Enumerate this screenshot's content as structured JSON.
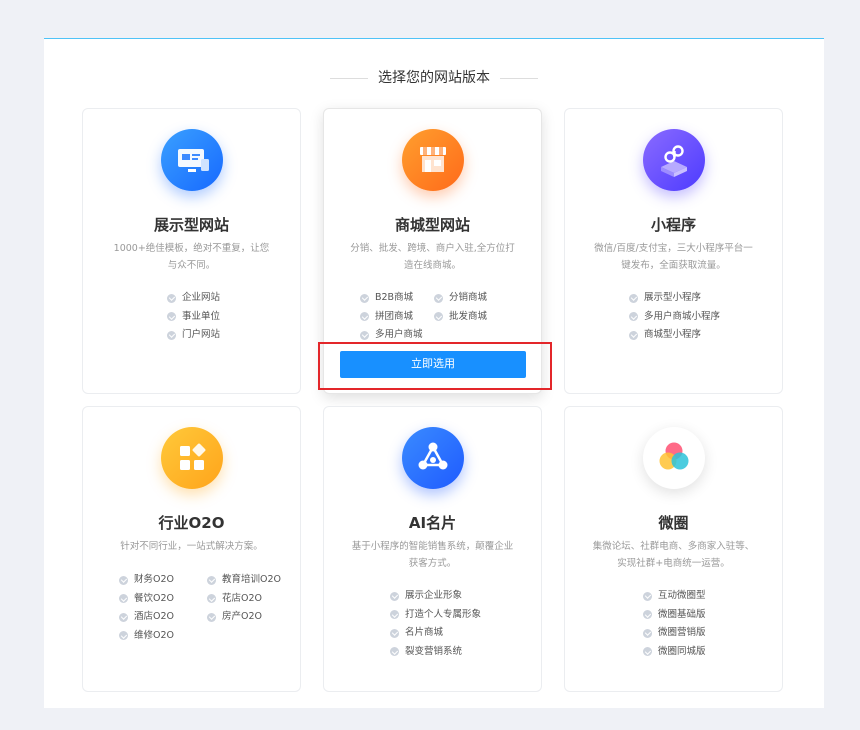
{
  "section_title": "选择您的网站版本",
  "cards": [
    {
      "icon": "display-screen-icon",
      "title": "展示型网站",
      "desc": "1000+绝佳模板，绝对不重复，让您与众不同。",
      "features": [
        "企业网站",
        "事业单位",
        "门户网站"
      ]
    },
    {
      "icon": "storefront-icon",
      "title": "商城型网站",
      "desc": "分销、批发、跨境、商户入驻,全方位打造在线商城。",
      "features": [
        "B2B商城",
        "分销商城",
        "拼团商城",
        "批发商城",
        "多用户商城"
      ],
      "button": "立即选用"
    },
    {
      "icon": "mini-program-icon",
      "title": "小程序",
      "desc": "微信/百度/支付宝，三大小程序平台一键发布，全面获取流量。",
      "features": [
        "展示型小程序",
        "多用户商城小程序",
        "商城型小程序"
      ]
    },
    {
      "icon": "blocks-icon",
      "title": "行业O2O",
      "desc": "针对不同行业，一站式解决方案。",
      "features": [
        "财务O2O",
        "教育培训O2O",
        "餐饮O2O",
        "花店O2O",
        "酒店O2O",
        "房产O2O",
        "维修O2O"
      ]
    },
    {
      "icon": "network-icon",
      "title": "AI名片",
      "desc": "基于小程序的智能销售系统，颠覆企业获客方式。",
      "features": [
        "展示企业形象",
        "打造个人专属形象",
        "名片商城",
        "裂变营销系统"
      ]
    },
    {
      "icon": "circles-icon",
      "title": "微圈",
      "desc": "集微论坛、社群电商、多商家入驻等、实现社群+电商统一运营。",
      "features": [
        "互动微圈型",
        "微圈基础版",
        "微圈营销版",
        "微圈同城版"
      ]
    }
  ],
  "colors": {
    "accent": "#1890ff",
    "highlight": "#e3262a"
  }
}
